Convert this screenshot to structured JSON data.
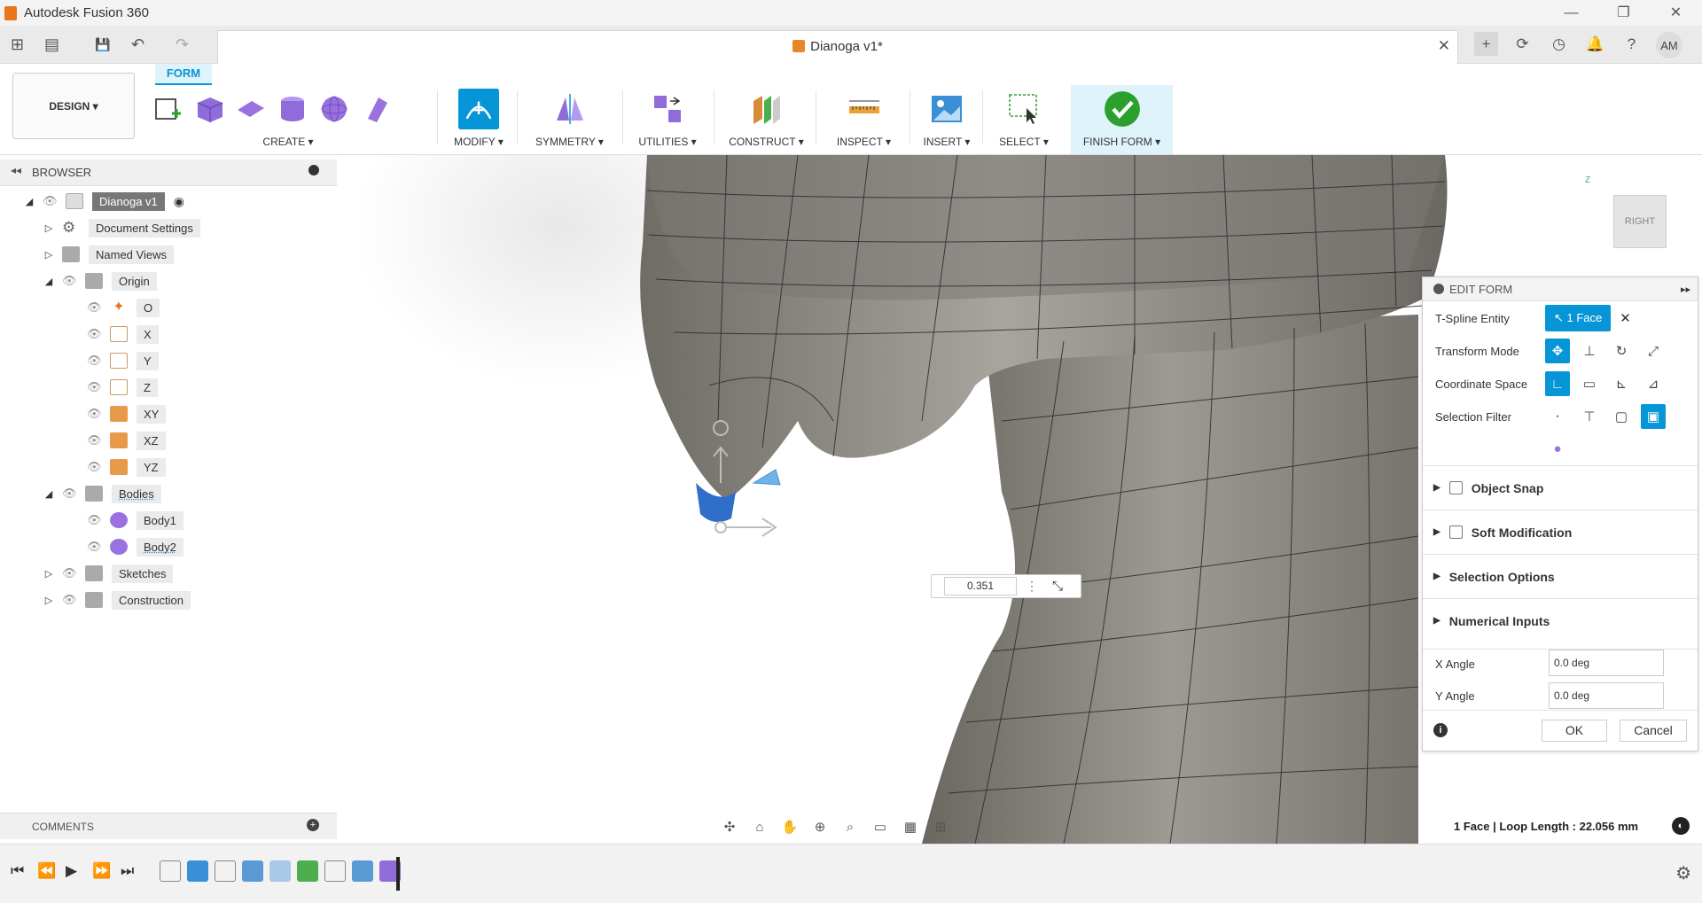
{
  "window": {
    "title": "Autodesk Fusion 360",
    "controls": [
      "—",
      "❐",
      "✕"
    ]
  },
  "document_tab": {
    "name": "Dianoga v1*",
    "close": "✕"
  },
  "quick_access": {
    "apps": "⊞",
    "file": "▤",
    "save": "💾",
    "undo": "↶",
    "redo": "↷"
  },
  "tab_actions": {
    "new_tab": "+",
    "user_initials": "AM"
  },
  "toolbar": {
    "workspace": "DESIGN ▾",
    "active_tab": "FORM",
    "groups": {
      "create": "CREATE ▾",
      "modify": "MODIFY ▾",
      "symmetry": "SYMMETRY ▾",
      "utilities": "UTILITIES ▾",
      "construct": "CONSTRUCT ▾",
      "inspect": "INSPECT ▾",
      "insert": "INSERT ▾",
      "select": "SELECT ▾",
      "finish": "FINISH FORM ▾"
    }
  },
  "browser": {
    "header": "BROWSER",
    "root": "Dianoga v1",
    "items": {
      "document_settings": "Document Settings",
      "named_views": "Named Views",
      "origin": "Origin",
      "o": "O",
      "x": "X",
      "y": "Y",
      "z": "Z",
      "xy": "XY",
      "xz": "XZ",
      "yz": "YZ",
      "bodies": "Bodies",
      "body1": "Body1",
      "body2": "Body2",
      "sketches": "Sketches",
      "construction": "Construction"
    }
  },
  "comments": {
    "header": "COMMENTS"
  },
  "viewcube": {
    "face": "RIGHT",
    "axis_z": "Z"
  },
  "manipulator_input": {
    "value": "0.351"
  },
  "edit_form": {
    "title": "EDIT FORM",
    "tspline_entity_label": "T-Spline Entity",
    "selection_chip": "1 Face",
    "transform_mode_label": "Transform Mode",
    "coordinate_space_label": "Coordinate Space",
    "selection_filter_label": "Selection Filter",
    "object_snap": "Object Snap",
    "soft_modification": "Soft Modification",
    "selection_options": "Selection Options",
    "numerical_inputs": "Numerical Inputs",
    "x_angle_label": "X Angle",
    "x_angle_value": "0.0 deg",
    "y_angle_label": "Y Angle",
    "y_angle_value": "0.0 deg",
    "ok": "OK",
    "cancel": "Cancel"
  },
  "status": {
    "text": "1 Face | Loop Length : 22.056 mm"
  },
  "colors": {
    "accent": "#0696d7",
    "mesh": "#8a8781",
    "selected_face": "#2f6fc9"
  }
}
